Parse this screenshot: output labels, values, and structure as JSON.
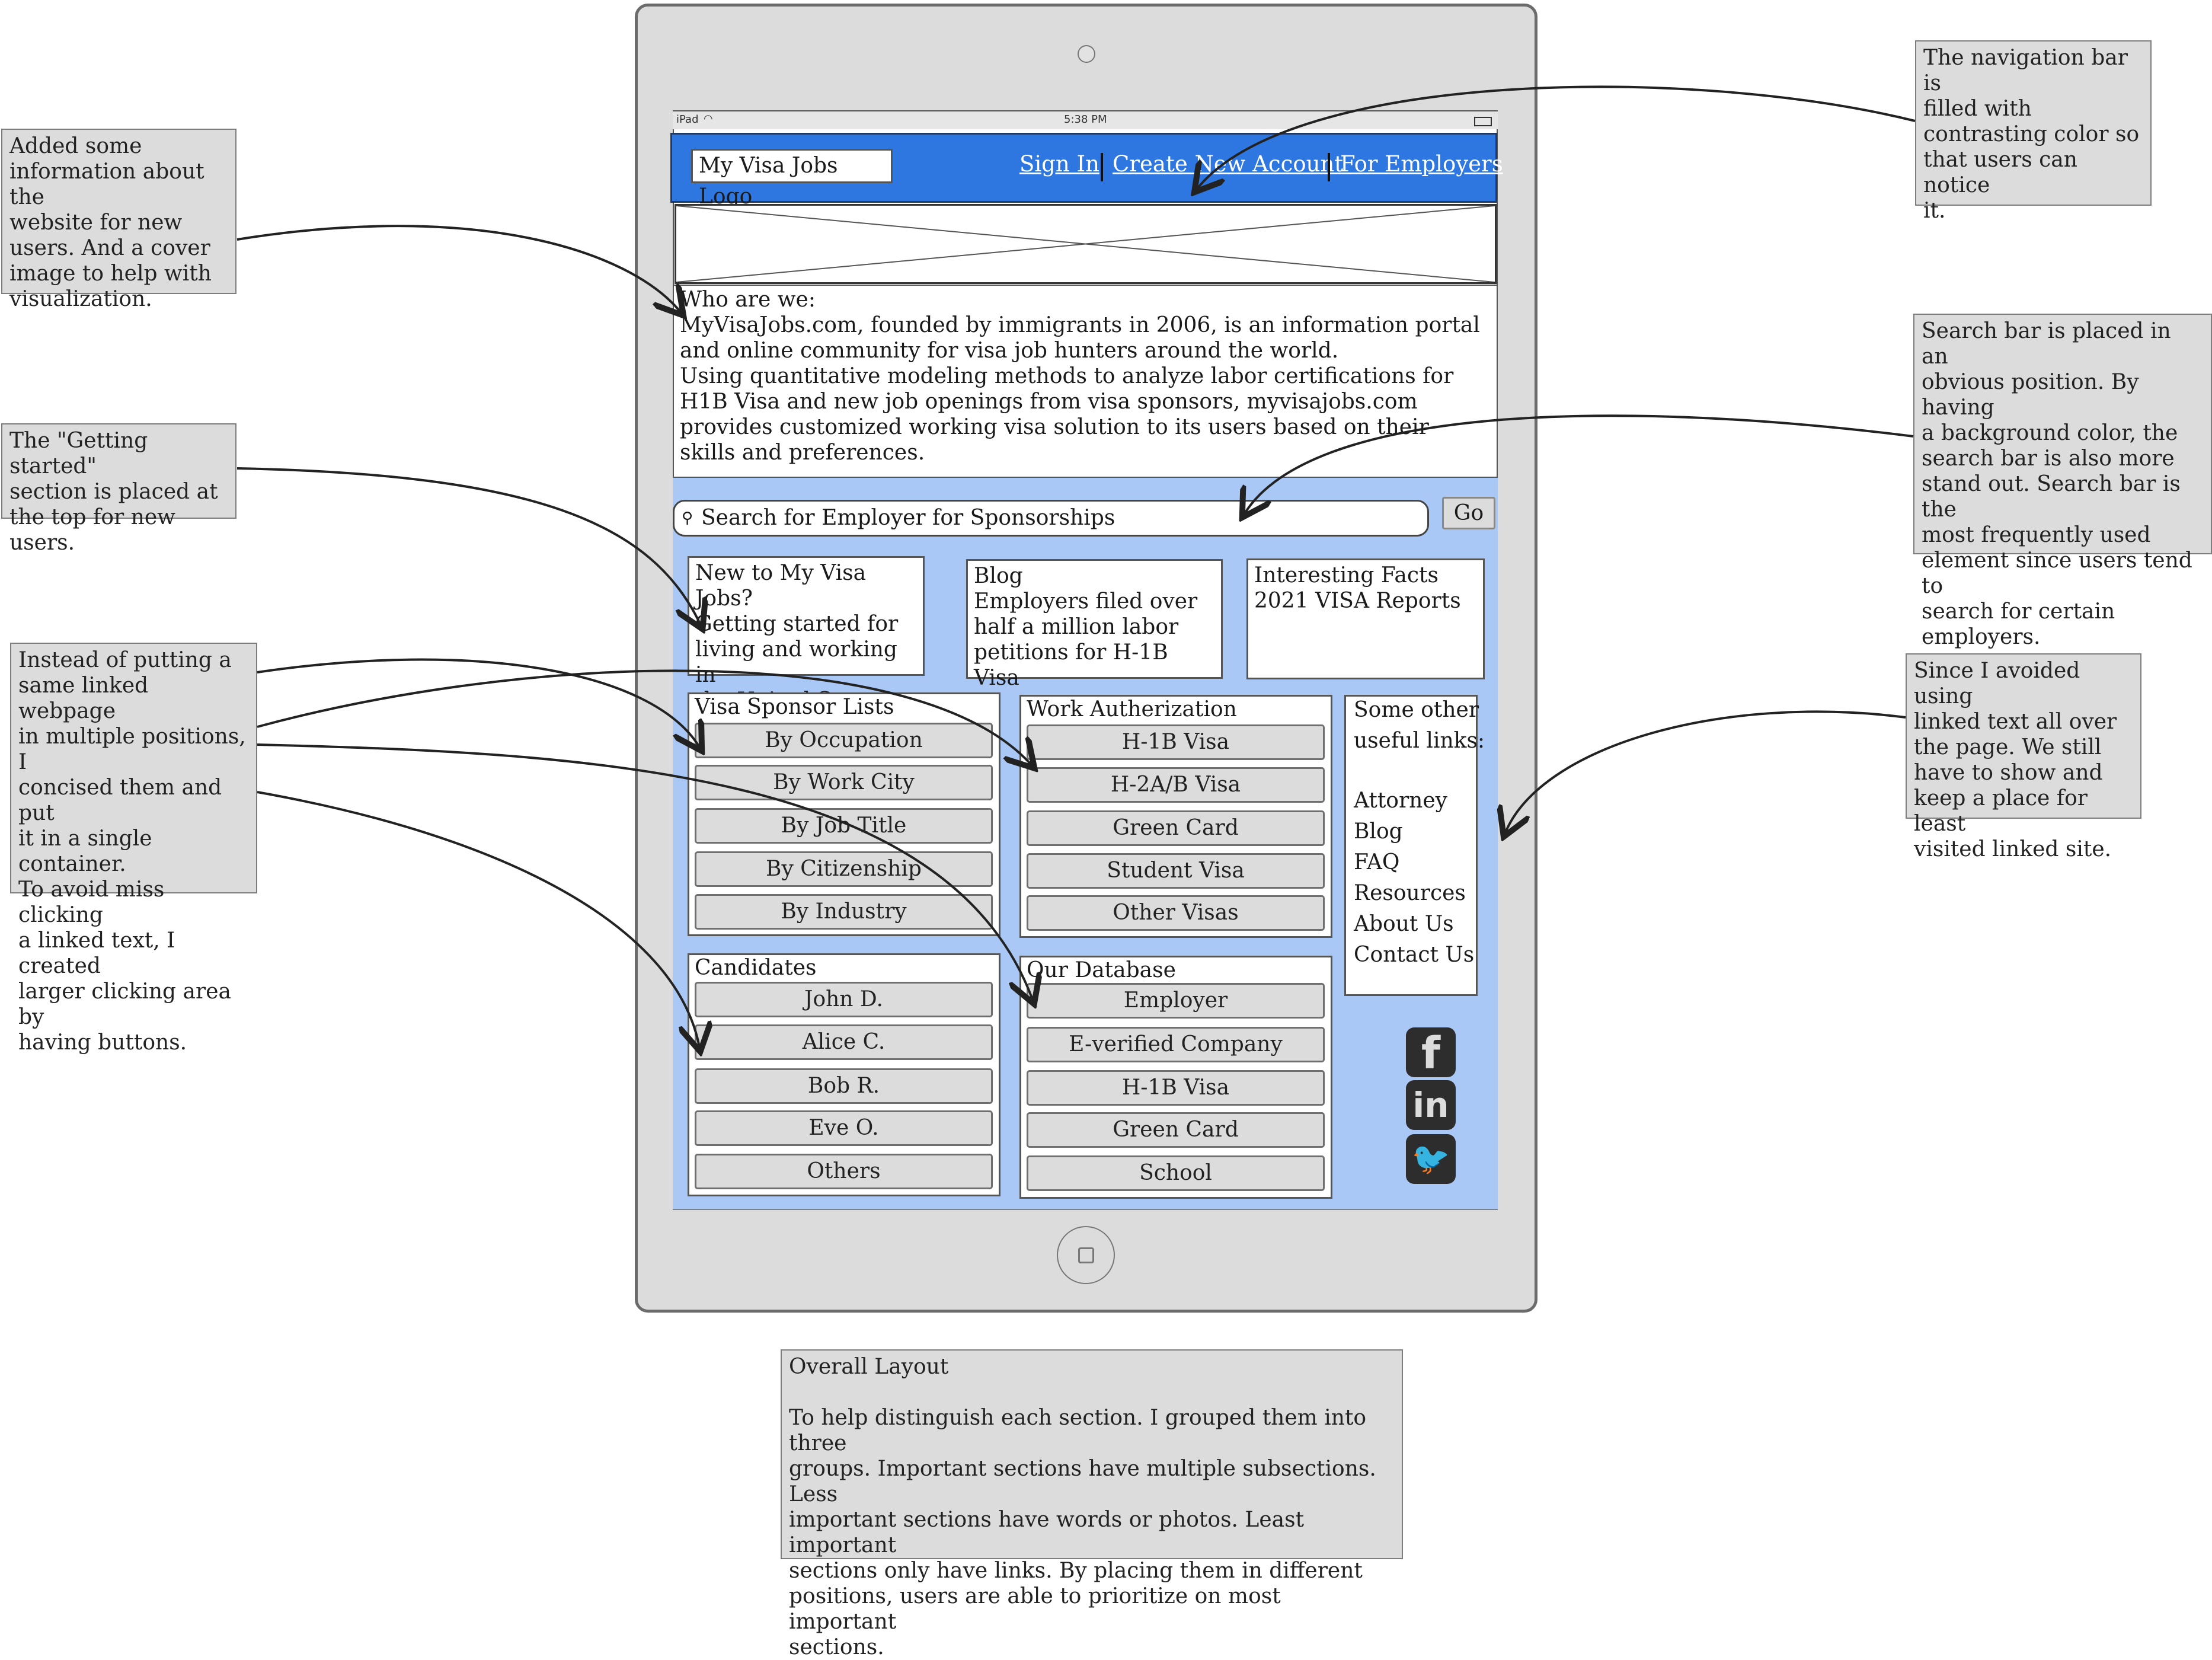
{
  "notes": {
    "nav_bar": "The navigation bar is\nfilled with\ncontrasting color so\nthat users can notice\nit.",
    "about": "Added some\ninformation about the\nwebsite for new\nusers. And a cover\nimage to help with\nvisualization.",
    "search": "Search bar is placed in an\nobvious position. By having\na background color, the\nsearch bar is also more\nstand out. Search bar is the\nmost frequently used\nelement since users tend to\nsearch for certain\nemployers.",
    "getting_started": "The \"Getting started\"\nsection is placed at\nthe top for new users.",
    "containers": "Instead of putting a\nsame linked webpage\nin multiple positions, I\nconcised them and put\nit in a single container.\nTo avoid miss clicking\na linked text, I created\nlarger clicking area by\nhaving buttons.",
    "links": "Since I avoided using\nlinked text all over\nthe page. We still\nhave to show and\nkeep a place for least\nvisited linked site.",
    "overall": "Overall Layout\n\nTo help distinguish each section. I grouped them into three\ngroups. Important sections have multiple subsections. Less\nimportant sections have words or photos. Least important\nsections only have links. By placing them in different\npositions, users are able to prioritize on most important\nsections."
  },
  "status_bar": {
    "device": "iPad",
    "time": "5:38 PM"
  },
  "nav": {
    "logo": "My Visa Jobs Logo",
    "sign_in": "Sign In",
    "create_account": "Create New Account",
    "for_employers": "For Employers"
  },
  "about": {
    "heading": "Who are we:",
    "p1": "MyVisaJobs.com, founded by immigrants in 2006, is an information portal and online community for visa job hunters around the world.",
    "p2": "Using quantitative modeling methods to analyze labor certifications for H1B Visa and new job openings from visa sponsors, myvisajobs.com provides customized working visa solution to its users based on their skills and preferences."
  },
  "search": {
    "placeholder": "Search for Employer for Sponsorships",
    "go": "Go"
  },
  "cards": {
    "getting_started": "New to My Visa Jobs?\nGetting started for\nliving and working in\nthe United States.",
    "blog": "Blog\nEmployers filed over\nhalf a million labor\npetitions for H-1B Visa",
    "facts": "Interesting Facts\n2021 VISA Reports"
  },
  "groups": {
    "sponsor": {
      "title": "Visa Sponsor Lists",
      "buttons": [
        "By Occupation",
        "By Work City",
        "By Job Title",
        "By Citizenship",
        "By Industry"
      ]
    },
    "work": {
      "title": "Work Autherization",
      "buttons": [
        "H-1B Visa",
        "H-2A/B Visa",
        "Green Card",
        "Student Visa",
        "Other Visas"
      ]
    },
    "candidates": {
      "title": "Candidates",
      "buttons": [
        "John D.",
        "Alice C.",
        "Bob R.",
        "Eve O.",
        "Others"
      ]
    },
    "database": {
      "title": "Our Database",
      "buttons": [
        "Employer",
        "E-verified Company",
        "H-1B Visa",
        "Green Card",
        "School"
      ]
    }
  },
  "links": {
    "title": "Some other\nuseful links:",
    "items": [
      "Attorney",
      "Blog",
      "FAQ",
      "Resources",
      "About Us",
      "Contact Us"
    ]
  },
  "social": {
    "facebook": {
      "glyph": "f",
      "icon": "facebook-icon"
    },
    "linkedin": {
      "glyph": "in",
      "icon": "linkedin-icon"
    },
    "twitter": {
      "glyph": "🐦",
      "icon": "twitter-icon"
    }
  },
  "colors": {
    "nav": "#2f77e0",
    "content": "#a9c8f5",
    "note": "#dcdcdc",
    "device": "#dcdcdc"
  }
}
